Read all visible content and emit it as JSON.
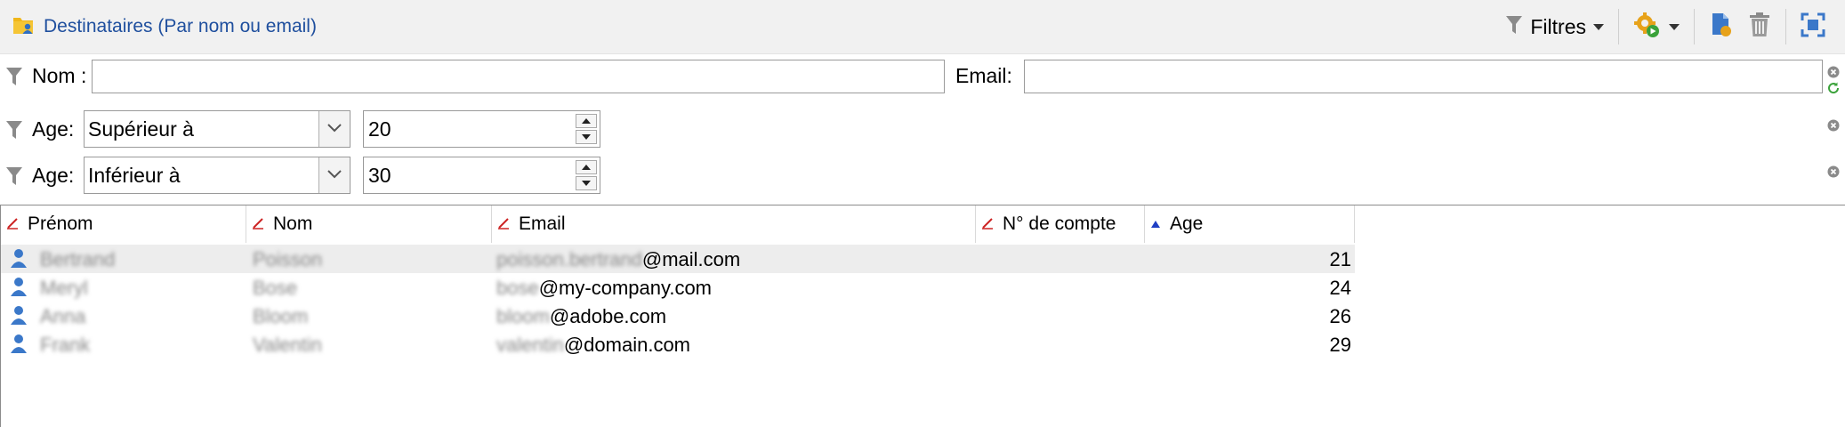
{
  "toolbar": {
    "title": "Destinataires (Par nom ou email)",
    "filters_label": "Filtres"
  },
  "filters": {
    "nom_label": "Nom :",
    "nom_value": "",
    "email_label": "Email:",
    "email_value": "",
    "age_rows": [
      {
        "label": "Age:",
        "operator": "Supérieur à",
        "value": "20"
      },
      {
        "label": "Age:",
        "operator": "Inférieur à",
        "value": "30"
      }
    ]
  },
  "table": {
    "columns": [
      "Prénom",
      "Nom",
      "Email",
      "N° de compte",
      "Age"
    ],
    "rows": [
      {
        "prenom": "Bertrand",
        "nom": "Poisson",
        "email_user": "poisson.bertrand",
        "email_domain": "@mail.com",
        "account": "",
        "age": "21"
      },
      {
        "prenom": "Meryl",
        "nom": "Bose",
        "email_user": "bose",
        "email_domain": "@my-company.com",
        "account": "",
        "age": "24"
      },
      {
        "prenom": "Anna",
        "nom": "Bloom",
        "email_user": "bloom",
        "email_domain": "@adobe.com",
        "account": "",
        "age": "26"
      },
      {
        "prenom": "Frank",
        "nom": "Valentin",
        "email_user": "valentin",
        "email_domain": "@domain.com",
        "account": "",
        "age": "29"
      }
    ]
  },
  "colors": {
    "title_blue": "#1f4f9e",
    "icon_blue": "#3b78c9",
    "sort_red": "#cc2222",
    "refresh_green": "#3aa23a"
  }
}
